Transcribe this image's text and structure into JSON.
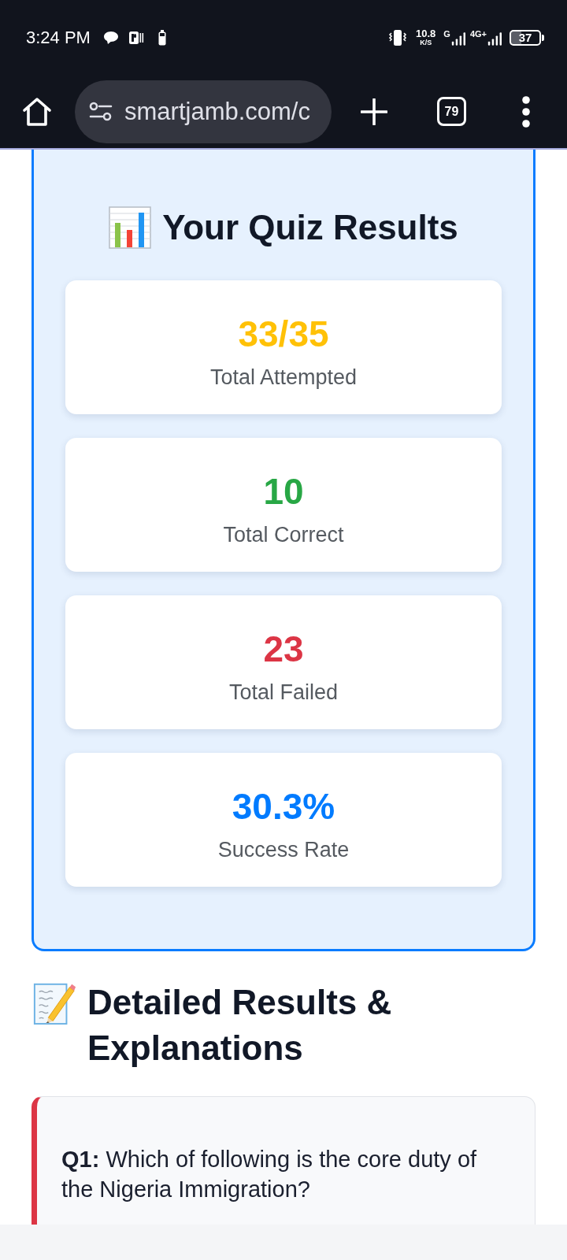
{
  "status_bar": {
    "time": "3:24 PM",
    "net_speed": "10.8",
    "speed_unit": "K/S",
    "networks": [
      {
        "label": "G"
      },
      {
        "label": "4G+"
      }
    ],
    "battery": "37"
  },
  "browser": {
    "url": "smartjamb.com/c",
    "tab_count": "79"
  },
  "results": {
    "title": "Your Quiz Results",
    "stats": [
      {
        "value": "33/35",
        "label": "Total Attempted",
        "color": "#ffc107"
      },
      {
        "value": "10",
        "label": "Total Correct",
        "color": "#28a745"
      },
      {
        "value": "23",
        "label": "Total Failed",
        "color": "#dc3545"
      },
      {
        "value": "30.3%",
        "label": "Success Rate",
        "color": "#007bff"
      }
    ]
  },
  "details": {
    "title": "Detailed Results & Explanations",
    "questions": [
      {
        "text": "**Q1:** Which of following is the core duty of the Nigeria Immigration?",
        "correct": false
      }
    ]
  }
}
